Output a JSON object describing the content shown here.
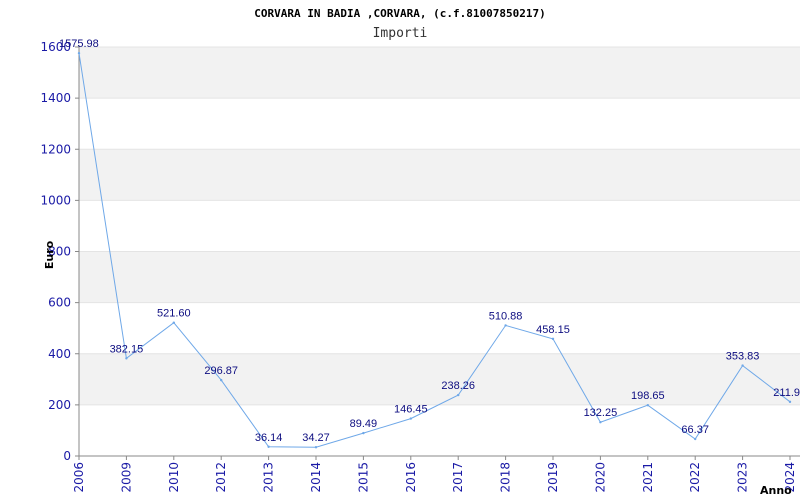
{
  "chart_data": {
    "type": "line",
    "title": "CORVARA IN BADIA ,CORVARA, (c.f.81007850217)",
    "subtitle": "Importi",
    "ylabel": "Euro",
    "xlabel": "Anno",
    "ylim": [
      0,
      1600
    ],
    "yticks": [
      0,
      200,
      400,
      600,
      800,
      1000,
      1200,
      1400,
      1600
    ],
    "grid": true,
    "x": [
      "2006",
      "2009",
      "2010",
      "2012",
      "2013",
      "2014",
      "2015",
      "2016",
      "2017",
      "2018",
      "2019",
      "2020",
      "2021",
      "2022",
      "2023",
      "2024"
    ],
    "values": [
      1575.98,
      382.15,
      521.6,
      296.87,
      36.14,
      34.27,
      89.49,
      146.45,
      238.26,
      510.88,
      458.15,
      132.25,
      198.65,
      66.37,
      353.83,
      211.9
    ],
    "data_labels": [
      "1575.98",
      "382.15",
      "521.60",
      "296.87",
      "36.14",
      "34.27",
      "89.49",
      "146.45",
      "238.26",
      "510.88",
      "458.15",
      "132.25",
      "198.65",
      "66.37",
      "353.83",
      "211.9"
    ],
    "colors": {
      "line": "#6fa8e8",
      "band": "#f2f2f2",
      "text": "#1a1aa6"
    }
  }
}
